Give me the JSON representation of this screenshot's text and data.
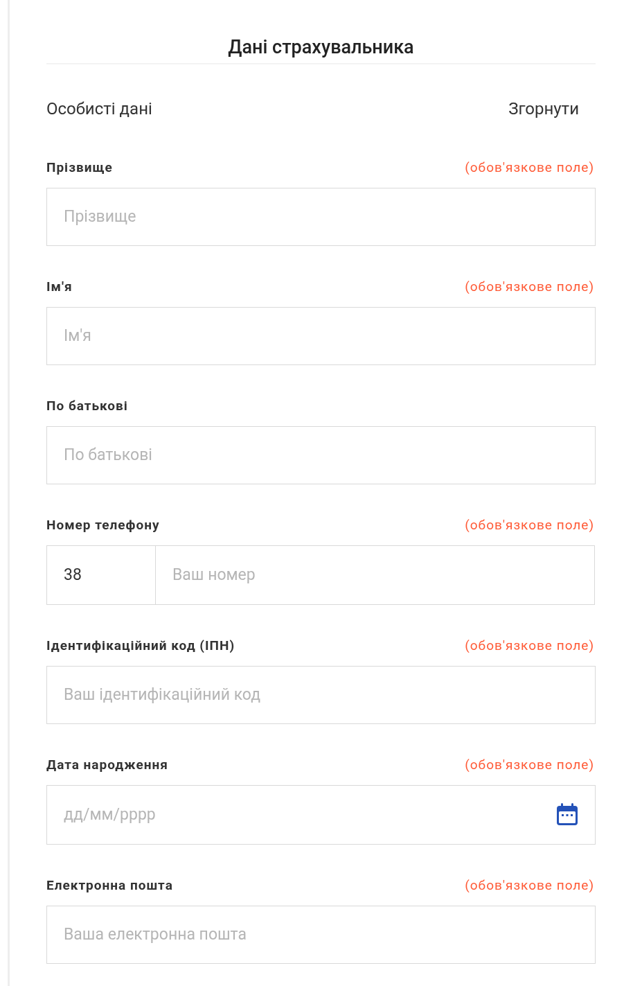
{
  "title": "Дані страхувальника",
  "section": {
    "title": "Особисті дані",
    "toggle": "Згорнути"
  },
  "fields": [
    {
      "kind": "text",
      "label": "Прізвище",
      "required_note": "(обов'язкове поле)",
      "placeholder": "Прізвище"
    },
    {
      "kind": "text",
      "label": "Ім'я",
      "required_note": "(обов'язкове поле)",
      "placeholder": "Ім'я"
    },
    {
      "kind": "text",
      "label": "По батькові",
      "placeholder": "По батькові"
    },
    {
      "kind": "phone",
      "label": "Номер телефону",
      "required_note": "(обов'язкове поле)",
      "prefix": "38",
      "placeholder": "Ваш номер"
    },
    {
      "kind": "text",
      "label": "Ідентифікаційний код (ІПН)",
      "required_note": "(обов'язкове поле)",
      "placeholder": "Ваш ідентифікаційний код"
    },
    {
      "kind": "date",
      "label": "Дата народження",
      "required_note": "(обов'язкове поле)",
      "placeholder": "дд/мм/рррр"
    },
    {
      "kind": "text",
      "label": "Електронна пошта",
      "required_note": "(обов'язкове поле)",
      "placeholder": "Ваша електронна пошта"
    }
  ]
}
